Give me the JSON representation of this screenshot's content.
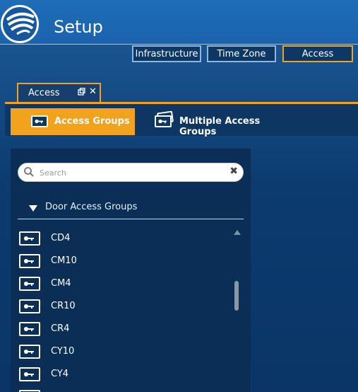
{
  "app": {
    "title": "Setup"
  },
  "nav_tabs": [
    {
      "label": "Infrastructure"
    },
    {
      "label": "Time Zone"
    },
    {
      "label": "Access"
    }
  ],
  "doc_tab": {
    "label": "Access"
  },
  "toolbar": {
    "access_groups_label": "Access Groups",
    "multiple_access_groups_label": "Multiple Access Groups"
  },
  "panel": {
    "search_placeholder": "Search",
    "group_header": "Door Access Groups",
    "items": [
      {
        "name": "CD4"
      },
      {
        "name": "CM10"
      },
      {
        "name": "CM4"
      },
      {
        "name": "CR10"
      },
      {
        "name": "CR4"
      },
      {
        "name": "CY10"
      },
      {
        "name": "CY4"
      },
      {
        "name": ""
      }
    ]
  },
  "colors": {
    "accent": "#f2a21c",
    "header": "#1f6cb8",
    "panel": "#0a2e56"
  },
  "icons": [
    "logo-icon",
    "float-window-icon",
    "close-icon",
    "key-icon",
    "keys-stack-icon",
    "search-icon",
    "clear-icon",
    "triangle-down-icon",
    "scroll-up-icon"
  ]
}
